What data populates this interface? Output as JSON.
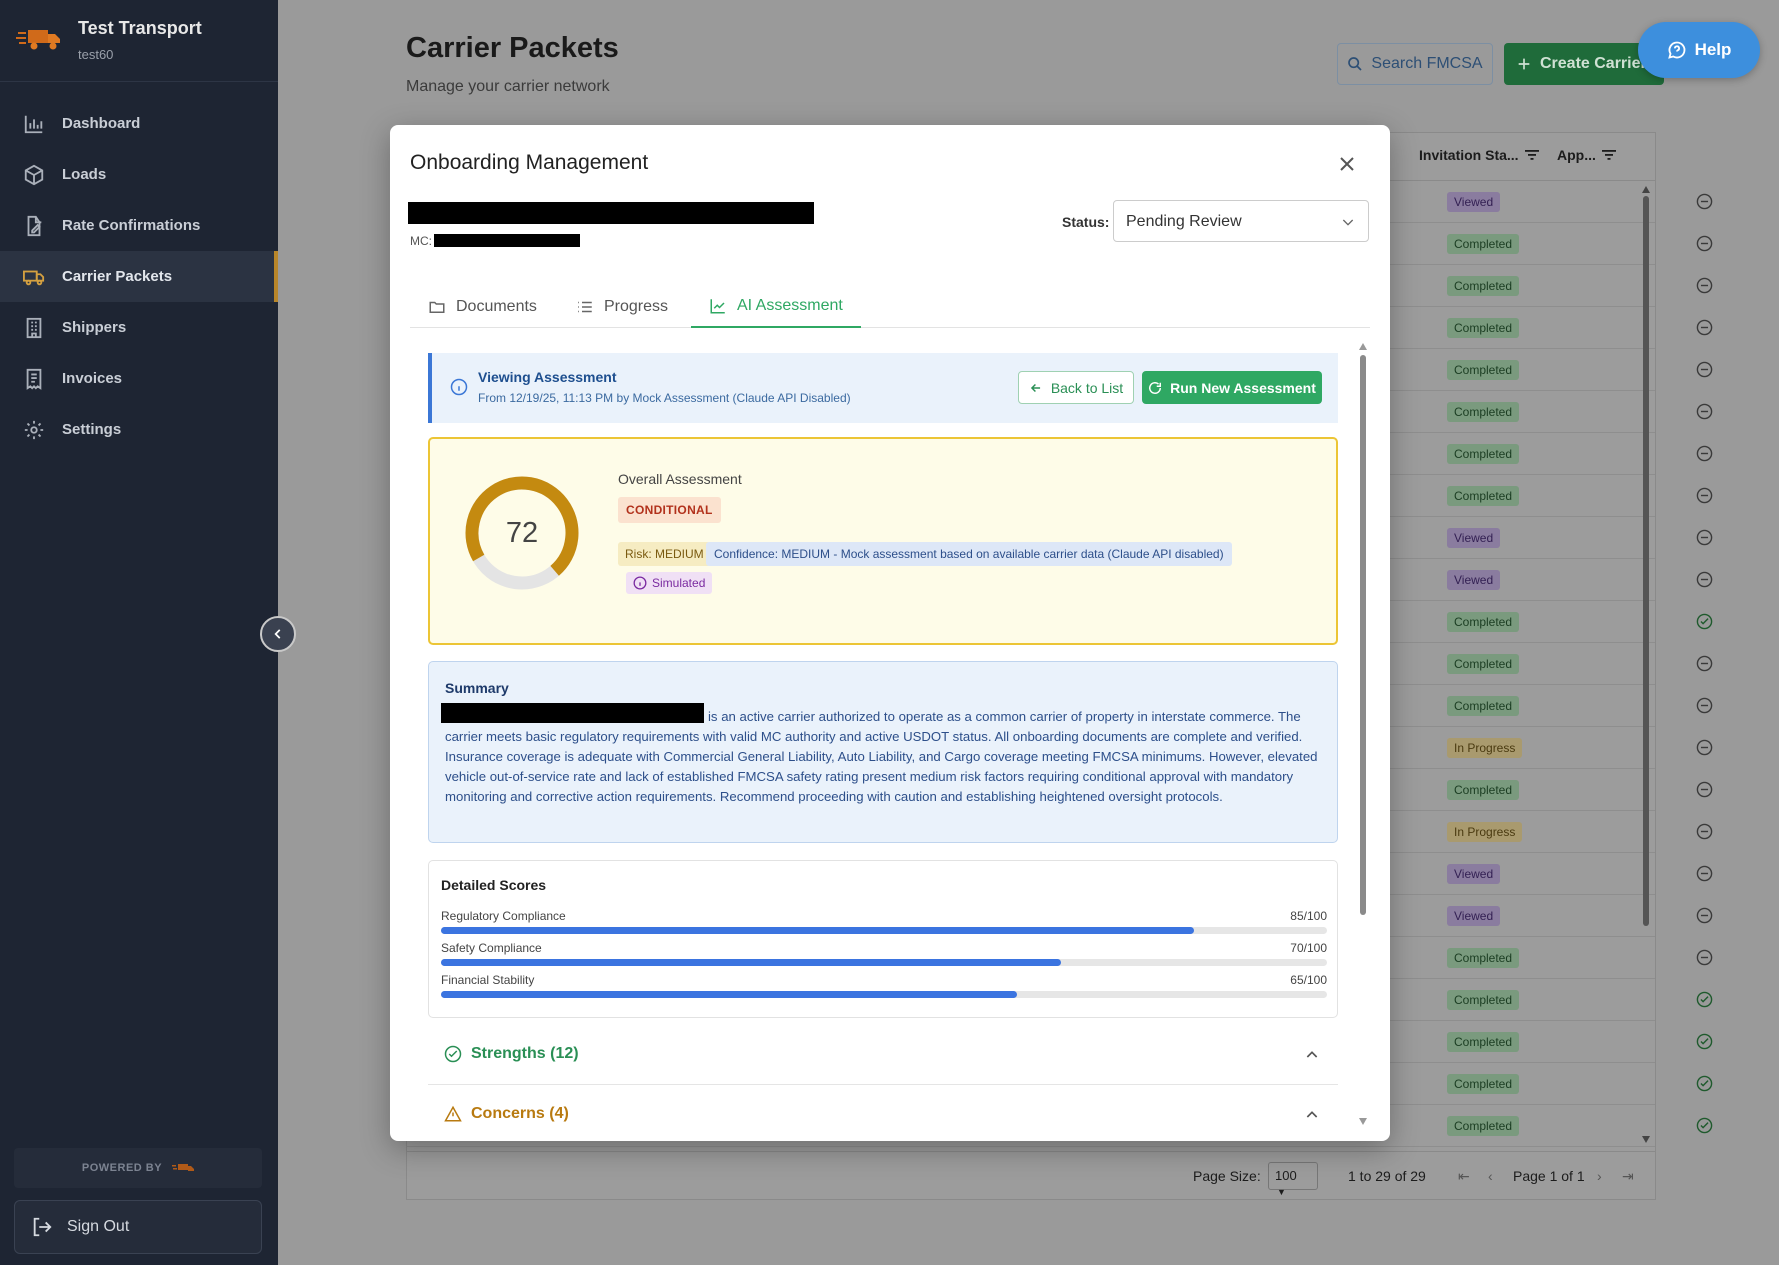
{
  "brand": {
    "name": "Test Transport",
    "sub": "test60"
  },
  "nav": [
    {
      "label": "Dashboard",
      "icon": "bar-chart-icon"
    },
    {
      "label": "Loads",
      "icon": "box-icon"
    },
    {
      "label": "Rate Confirmations",
      "icon": "file-edit-icon"
    },
    {
      "label": "Carrier Packets",
      "icon": "truck-icon"
    },
    {
      "label": "Shippers",
      "icon": "building-icon"
    },
    {
      "label": "Invoices",
      "icon": "receipt-icon"
    },
    {
      "label": "Settings",
      "icon": "gear-icon"
    }
  ],
  "active_nav": "Carrier Packets",
  "powered_by": "POWERED BY",
  "sign_out": "Sign Out",
  "page": {
    "title": "Carrier Packets",
    "subtitle": "Manage your carrier network",
    "search_fmcsa": "Search FMCSA",
    "create_carrier": "Create Carrier",
    "help": "Help"
  },
  "grid": {
    "columns": [
      "Invitation Sta...",
      "App..."
    ],
    "rows": [
      {
        "status": "Viewed",
        "approved": false
      },
      {
        "status": "Completed",
        "approved": false
      },
      {
        "status": "Completed",
        "approved": false
      },
      {
        "status": "Completed",
        "approved": false
      },
      {
        "status": "Completed",
        "approved": false
      },
      {
        "status": "Completed",
        "approved": false
      },
      {
        "status": "Completed",
        "approved": false
      },
      {
        "status": "Completed",
        "approved": false
      },
      {
        "status": "Viewed",
        "approved": false
      },
      {
        "status": "Viewed",
        "approved": false
      },
      {
        "status": "Completed",
        "approved": true
      },
      {
        "status": "Completed",
        "approved": false
      },
      {
        "status": "Completed",
        "approved": false
      },
      {
        "status": "In Progress",
        "approved": false
      },
      {
        "status": "Completed",
        "approved": false
      },
      {
        "status": "In Progress",
        "approved": false
      },
      {
        "status": "Viewed",
        "approved": false
      },
      {
        "status": "Viewed",
        "approved": false
      },
      {
        "status": "Completed",
        "approved": false
      },
      {
        "status": "Completed",
        "approved": true
      },
      {
        "status": "Completed",
        "approved": true
      },
      {
        "status": "Completed",
        "approved": true
      },
      {
        "status": "Completed",
        "approved": true
      }
    ],
    "footer": {
      "page_size_label": "Page Size:",
      "page_size": "100",
      "range": "1 to 29 of 29",
      "page_label": "Page 1 of 1"
    }
  },
  "modal": {
    "title": "Onboarding Management",
    "mc_label": "MC:",
    "status_label": "Status:",
    "status_value": "Pending Review",
    "tabs": [
      {
        "label": "Documents",
        "icon": "folder-icon"
      },
      {
        "label": "Progress",
        "icon": "list-icon"
      },
      {
        "label": "AI Assessment",
        "icon": "chart-line-icon"
      }
    ],
    "active_tab": "AI Assessment",
    "banner": {
      "title": "Viewing Assessment",
      "subtitle": "From 12/19/25, 11:13 PM by Mock Assessment (Claude API Disabled)",
      "back": "Back to List",
      "run": "Run New Assessment"
    },
    "overall": {
      "score": 72,
      "max": 100,
      "label": "Overall Assessment",
      "decision": "CONDITIONAL",
      "risk": "Risk: MEDIUM",
      "confidence": "Confidence: MEDIUM - Mock assessment based on available carrier data (Claude API disabled)",
      "simulated": "Simulated",
      "gauge_color": "#c48a10"
    },
    "summary": {
      "title": "Summary",
      "text": "is an active carrier authorized to operate as a common carrier of property in interstate commerce. The carrier meets basic regulatory requirements with valid MC authority and active USDOT status. All onboarding documents are complete and verified. Insurance coverage is adequate with Commercial General Liability, Auto Liability, and Cargo coverage meeting FMCSA minimums. However, elevated vehicle out-of-service rate and lack of established FMCSA safety rating present medium risk factors requiring conditional approval with mandatory monitoring and corrective action requirements. Recommend proceeding with caution and establishing heightened oversight protocols."
    },
    "scores": {
      "title": "Detailed Scores",
      "items": [
        {
          "name": "Regulatory Compliance",
          "value": 85,
          "display": "85/100"
        },
        {
          "name": "Safety Compliance",
          "value": 70,
          "display": "70/100"
        },
        {
          "name": "Financial Stability",
          "value": 65,
          "display": "65/100"
        }
      ]
    },
    "strengths": "Strengths (12)",
    "concerns": "Concerns (4)"
  },
  "colors": {
    "accent_green": "#2fa863",
    "accent_blue": "#3b74e0",
    "warning": "#ecc535"
  }
}
